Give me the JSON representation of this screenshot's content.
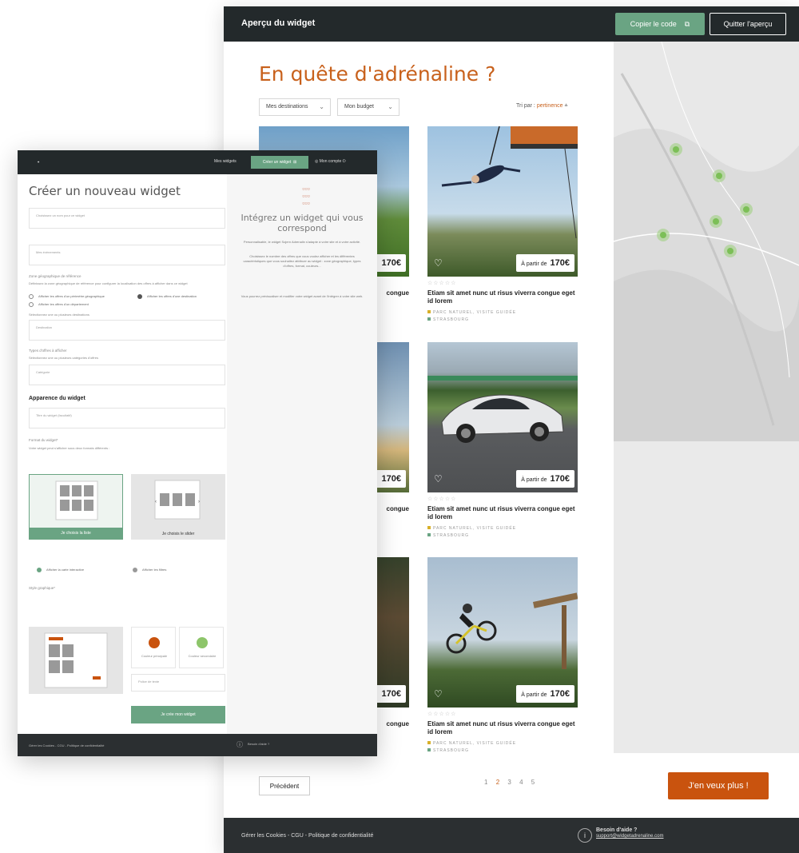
{
  "preview": {
    "title": "Aperçu du widget",
    "copy_label": "Copier le code",
    "quit_label": "Quitter l'aperçu",
    "headline": "En quête d'adrénaline ?",
    "filters": [
      "Mes destinations",
      "Mon budget"
    ],
    "sort_label": "Tri par :",
    "sort_value": "pertinence",
    "cards": [
      {
        "price_prefix": "À partir de",
        "price": "170€",
        "title": "Etiam sit amet nunc ut risus viverra congue eget id lorem",
        "tag": "PARC NATUREL, VISITE GUIDÉE",
        "location": "STRASBOURG"
      },
      {
        "price_prefix": "À partir de",
        "price": "170€",
        "title": "Etiam sit amet nunc ut risus viverra congue eget id lorem",
        "tag": "PARC NATUREL, VISITE GUIDÉE",
        "location": "STRASBOURG"
      },
      {
        "price_prefix": "À partir de",
        "price": "170€",
        "title": "Etiam sit amet nunc ut risus viverra congue eget id lorem",
        "tag": "PARC NATUREL, VISITE GUIDÉE",
        "location": "STRASBOURG"
      }
    ],
    "partial_prices": [
      "170€",
      "170€",
      "170€"
    ],
    "partial_titles": [
      "congue",
      "congue",
      "congue"
    ],
    "pager": {
      "prev": "Précédent",
      "pages": [
        "1",
        "2",
        "3",
        "4",
        "5"
      ],
      "active": "2"
    },
    "more_label": "J'en veux plus !",
    "footer": {
      "links": "Gérer les Cookies - CGU - Politique de confidentialité",
      "help_title": "Besoin d'aide ?",
      "help_link": "support@widgetadrenaline.com"
    },
    "colors": {
      "accent": "#c8611c",
      "green": "#6aa483",
      "dark": "#23292b"
    }
  },
  "editor": {
    "nav_link": "Mes widgets",
    "create_label": "Créer un widget",
    "account_label": "Mon compte",
    "title": "Créer un nouveau widget",
    "side_title": "Intégrez un widget qui vous correspond",
    "side_p1": "Personnalisable, le widget Sojern Adrenalin s'adapte à votre site et à votre activité.",
    "side_p2": "Choisissez le nombre des offres que vous voulez afficher et les différentes caractéristiques que vous souhaitez attribuer au widget : zone géographique, types d'offres, format, couleurs...",
    "side_p3": "Vous pourrez prévisualiser et modifier votre widget avant de l'intégrer à votre site web.",
    "intro_hint": "Choisissez un nom pour ce widget",
    "placeholder_name": "Mes évènements",
    "section_zone": "Zone géographique de référence",
    "zone_hint": "Définissez la zone géographique de référence pour configurer la localisation des offres à afficher dans ce widget",
    "radio_1": "Afficher les offres d'un périmètre géographique",
    "radio_2": "Afficher les offres d'une destination",
    "radio_3": "Afficher les offres d'un département",
    "dest_label": "Sélectionnez une ou plusieurs destinations",
    "dest_placeholder": "Destination",
    "section_types": "Types d'offres à afficher",
    "types_hint": "Sélectionnez une ou plusieurs catégories d'offres",
    "types_placeholder": "Catégorie",
    "section_appearance": "Apparence du widget",
    "title_field": "Titre du widget (facultatif)",
    "section_format": "Format du widget*",
    "format_hint": "Votre widget peut s'afficher sous deux formats différents :",
    "format_1": "Je choisis la liste",
    "format_2": "Je choisis le slider",
    "map_option": "Afficher la carte interactive",
    "no_map_option": "Afficher les filtres",
    "section_graphic": "Style graphique*",
    "color_1": "Couleur principale",
    "color_2": "Couleur secondaire",
    "font_label": "Police de texte",
    "submit": "Je crée mon widget",
    "footer_links": "Gérer les Cookies - CGU - Politique de confidentialité",
    "footer_help": "Besoin d'aide ?",
    "colors": {
      "primary": "#c9530e",
      "secondary": "#8dc56a"
    }
  }
}
